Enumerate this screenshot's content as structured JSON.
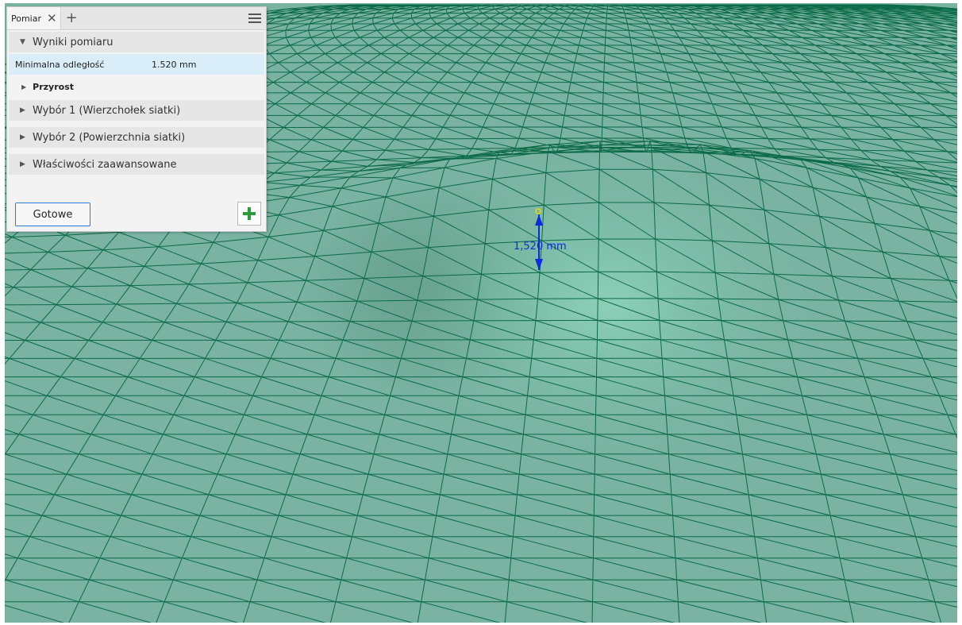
{
  "panel": {
    "tab_title": "Pomiar",
    "close_symbol": "✕",
    "add_tab_symbol": "+",
    "menu_icon": "hamburger-menu-icon",
    "sections": {
      "results": {
        "label": "Wyniki pomiaru",
        "expanded": true
      },
      "selection1": {
        "label": "Wybór 1 (Wierzchołek siatki)",
        "expanded": false
      },
      "selection2": {
        "label": "Wybór 2 (Powierzchnia siatki)",
        "expanded": false
      },
      "advanced": {
        "label": "Właściwości zaawansowane",
        "expanded": false
      }
    },
    "result": {
      "label": "Minimalna odległość",
      "value": "1.520 mm"
    },
    "increment": {
      "label": "Przyrost",
      "expanded": false
    },
    "done_label": "Gotowe",
    "add_icon": "green-plus-icon"
  },
  "viewport": {
    "dimension_label": "1,520 mm",
    "mesh_color": "#7ab3a1",
    "edge_color": "#0b6a48",
    "arrow_color": "#0a2be0",
    "vertex_color": "#e8d800"
  }
}
